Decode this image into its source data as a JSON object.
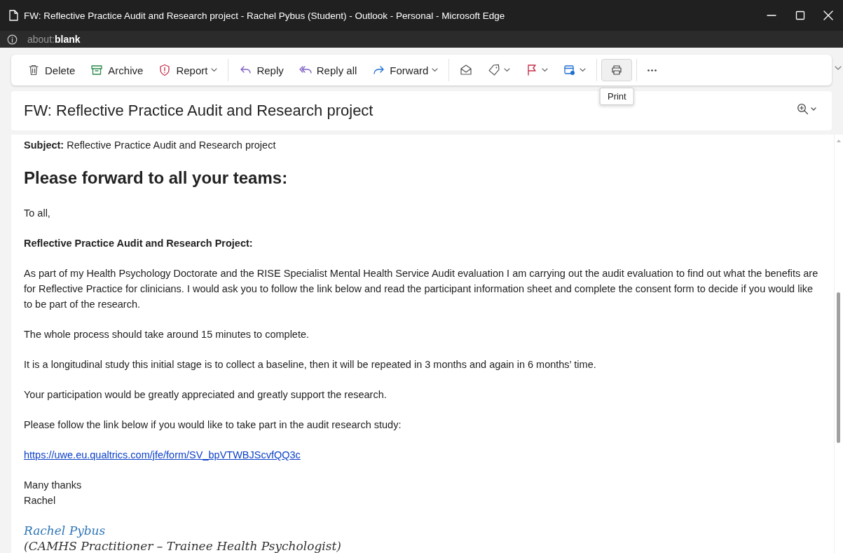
{
  "window": {
    "title": "FW: Reflective Practice Audit and Research project - Rachel Pybus (Student) - Outlook - Personal - Microsoft Edge"
  },
  "address_bar": {
    "scheme": "about:",
    "host": "blank"
  },
  "toolbar": {
    "groups": [
      [
        {
          "label": "Delete",
          "dropdown": false,
          "hovered": false
        },
        {
          "label": "Archive",
          "dropdown": false,
          "hovered": false
        },
        {
          "label": "Report",
          "dropdown": true,
          "hovered": false
        }
      ],
      [
        {
          "label": "Reply",
          "dropdown": false,
          "hovered": false
        },
        {
          "label": "Reply all",
          "dropdown": false,
          "hovered": false
        },
        {
          "label": "Forward",
          "dropdown": true,
          "hovered": false
        }
      ],
      [
        {
          "dropdown": false,
          "hovered": false
        },
        {
          "dropdown": true,
          "hovered": false
        },
        {
          "dropdown": true,
          "hovered": false
        },
        {
          "dropdown": true,
          "hovered": false
        }
      ],
      [
        {
          "dropdown": false,
          "hovered": true,
          "tooltip": "Print"
        }
      ],
      [
        {
          "dropdown": false,
          "hovered": false
        }
      ]
    ]
  },
  "message": {
    "subject": "FW: Reflective Practice Audit and Research project",
    "blocks": [
      {
        "kind": "text",
        "text": "**Subject:** Reflective Practice Audit and Research project"
      },
      {
        "kind": "heading",
        "text": "Please forward to all your teams:"
      },
      {
        "kind": "text",
        "text": "To all,"
      },
      {
        "kind": "strong",
        "text": "Reflective Practice Audit and Research Project:"
      },
      {
        "kind": "text",
        "text": "As part of my Health Psychology Doctorate and the RISE Specialist Mental Health Service Audit evaluation I am carrying out the audit evaluation to find out what the benefits are for Reflective Practice for clinicians. I would ask you to follow the link below and read the participant information sheet and complete the consent form to decide if you would like to be part of the research."
      },
      {
        "kind": "text",
        "text": "The whole process should take around 15 minutes to complete."
      },
      {
        "kind": "text",
        "text": "It is a longitudinal study this initial stage is to collect a baseline, then it will be repeated in 3 months and again in 6 months’ time."
      },
      {
        "kind": "text",
        "text": "Your participation would be greatly appreciated and greatly support the research."
      },
      {
        "kind": "text",
        "text": "Please follow the link below if you would like to take part in the audit research study:"
      },
      {
        "kind": "link",
        "text": "https://uwe.eu.qualtrics.com/jfe/form/SV_bpVTWBJScvfQQ3c"
      },
      {
        "kind": "line",
        "text": "Many thanks"
      },
      {
        "kind": "text",
        "text": "Rachel"
      },
      {
        "kind": "signature-name",
        "text": "Rachel Pybus"
      },
      {
        "kind": "signature-role",
        "text": "(CAMHS Practitioner – Trainee Health Psychologist)"
      }
    ]
  }
}
